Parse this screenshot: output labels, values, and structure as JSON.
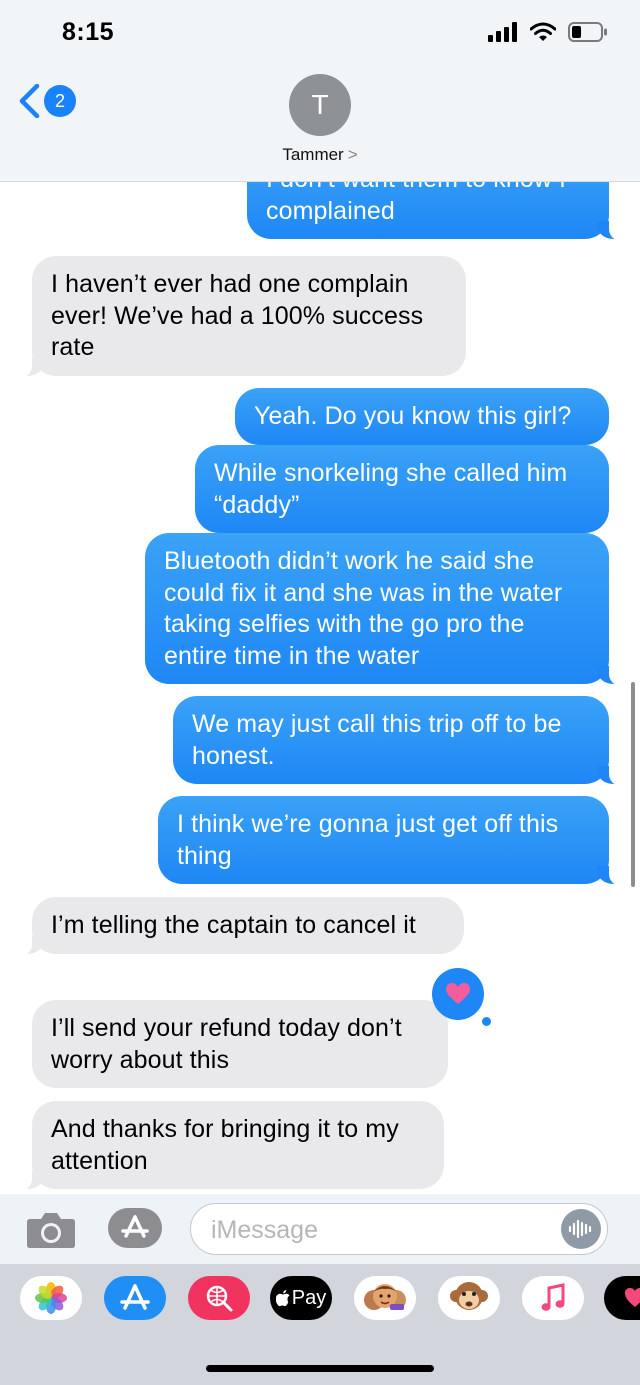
{
  "status_bar": {
    "time": "8:15"
  },
  "header": {
    "back_count": "2",
    "avatar_initial": "T",
    "contact_name": "Tammer",
    "chevron": ">"
  },
  "messages": [
    {
      "type": "sent",
      "text": "I don’t want them to know I complained"
    },
    {
      "type": "received",
      "text": "I haven’t ever had one complain ever!  We’ve had a 100% success rate"
    },
    {
      "type": "sent",
      "text": "Yeah. Do you know this girl?"
    },
    {
      "type": "sent",
      "text": "While snorkeling she called him “daddy”"
    },
    {
      "type": "sent",
      "text": "Bluetooth didn’t work he said she could fix it and she was in the water taking selfies with the go pro the entire time in the water"
    },
    {
      "type": "sent",
      "text": "We may just call this trip off to be honest."
    },
    {
      "type": "sent",
      "text": "I think we’re gonna just get off this thing"
    },
    {
      "type": "received",
      "text": "I’m telling the captain to cancel it"
    },
    {
      "type": "received",
      "text": "I’ll send your refund today don’t worry about this",
      "tapback": "heart-icon"
    },
    {
      "type": "received",
      "text": "And thanks for bringing it to my attention"
    }
  ],
  "input": {
    "placeholder": "iMessage"
  },
  "drawer": {
    "apple_pay_label": "Pay"
  },
  "colors": {
    "sent_bubble": "#1e87f5",
    "received_bubble": "#e9e9eb",
    "badge": "#1a82fb"
  }
}
